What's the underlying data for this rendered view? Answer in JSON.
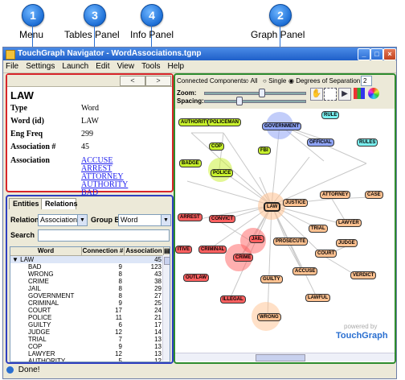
{
  "callouts": [
    {
      "number": "1",
      "label": "Menu"
    },
    {
      "number": "3",
      "label": "Tables Panel"
    },
    {
      "number": "4",
      "label": "Info Panel"
    },
    {
      "number": "2",
      "label": "Graph Panel"
    }
  ],
  "window": {
    "title": "TouchGraph Navigator - WordAssociations.tgnp",
    "buttons": [
      "_",
      "□",
      "×"
    ]
  },
  "menubar": {
    "items": [
      "File",
      "Settings",
      "Launch",
      "Edit",
      "View",
      "Tools",
      "Help"
    ]
  },
  "info_panel": {
    "nav_back": "<",
    "nav_forward": ">",
    "title": "LAW",
    "rows": [
      {
        "key": "Type",
        "value": "Word"
      },
      {
        "key": "Word (id)",
        "value": "LAW"
      },
      {
        "key": "Eng Freq",
        "value": "299"
      },
      {
        "key": "Association #",
        "value": "45"
      }
    ],
    "association_key": "Association",
    "associations": [
      "ACCUSE",
      "ARREST",
      "ATTORNEY",
      "AUTHORITY",
      "BAD"
    ]
  },
  "tables_panel": {
    "tabs": [
      "Entities",
      "Relations"
    ],
    "relation_label": "Relation:",
    "relation_value": "Association",
    "group_by_label": "Group By:",
    "group_by_value": "Word",
    "search_label": "Search",
    "search_value": "",
    "columns": [
      "Word",
      "Connection #",
      "Association #"
    ],
    "group_row": {
      "word": "LAW",
      "association": "45"
    },
    "rows": [
      {
        "word": "BAD",
        "connection": "9",
        "association": "123"
      },
      {
        "word": "WRONG",
        "connection": "8",
        "association": "43"
      },
      {
        "word": "CRIME",
        "connection": "8",
        "association": "38"
      },
      {
        "word": "JAIL",
        "connection": "8",
        "association": "29"
      },
      {
        "word": "GOVERNMENT",
        "connection": "8",
        "association": "27"
      },
      {
        "word": "CRIMINAL",
        "connection": "9",
        "association": "25"
      },
      {
        "word": "COURT",
        "connection": "17",
        "association": "24"
      },
      {
        "word": "POLICE",
        "connection": "11",
        "association": "21"
      },
      {
        "word": "GUILTY",
        "connection": "6",
        "association": "17"
      },
      {
        "word": "JUDGE",
        "connection": "12",
        "association": "14"
      },
      {
        "word": "TRIAL",
        "connection": "7",
        "association": "13"
      },
      {
        "word": "COP",
        "connection": "9",
        "association": "13"
      },
      {
        "word": "LAWYER",
        "connection": "12",
        "association": "13"
      },
      {
        "word": "AUTHORITY",
        "connection": "5",
        "association": "12"
      }
    ]
  },
  "graph_panel": {
    "connected_label": "Connected Components:",
    "options": [
      "All",
      "Single",
      "Degrees of Separation"
    ],
    "selected_option": "Degrees of Separation",
    "degrees_value": "2",
    "zoom_label": "Zoom:",
    "spacing_label": "Spacing:",
    "watermark_top": "powered by",
    "watermark_brand": "TouchGraph",
    "nodes": [
      {
        "label": "AUTHORITY",
        "color": "lime"
      },
      {
        "label": "POLICEMAN",
        "color": "lime"
      },
      {
        "label": "COP",
        "color": "lime"
      },
      {
        "label": "FBI",
        "color": "lime"
      },
      {
        "label": "BADGE",
        "color": "lime"
      },
      {
        "label": "POLICE",
        "color": "lime"
      },
      {
        "label": "GOVERNMENT",
        "color": "blue"
      },
      {
        "label": "OFFICIAL",
        "color": "blue"
      },
      {
        "label": "RULE",
        "color": "cyan"
      },
      {
        "label": "RULES",
        "color": "cyan"
      },
      {
        "label": "LAW",
        "color": "orange"
      },
      {
        "label": "JUSTICE",
        "color": "orange"
      },
      {
        "label": "ATTORNEY",
        "color": "orange"
      },
      {
        "label": "CASE",
        "color": "orange"
      },
      {
        "label": "LAWYER",
        "color": "orange"
      },
      {
        "label": "TRIAL",
        "color": "orange"
      },
      {
        "label": "JUDGE",
        "color": "orange"
      },
      {
        "label": "COURT",
        "color": "orange"
      },
      {
        "label": "PROSECUTE",
        "color": "orange"
      },
      {
        "label": "ACCUSE",
        "color": "orange"
      },
      {
        "label": "VERDICT",
        "color": "orange"
      },
      {
        "label": "GUILTY",
        "color": "orange"
      },
      {
        "label": "LAWFUL",
        "color": "orange"
      },
      {
        "label": "WRONG",
        "color": "orange"
      },
      {
        "label": "ARREST",
        "color": "red"
      },
      {
        "label": "CONVICT",
        "color": "red"
      },
      {
        "label": "JAIL",
        "color": "red"
      },
      {
        "label": "CRIMINAL",
        "color": "red"
      },
      {
        "label": "CRIME",
        "color": "red"
      },
      {
        "label": "OUTLAW",
        "color": "red"
      },
      {
        "label": "ILLEGAL",
        "color": "red"
      },
      {
        "label": "ITIVE",
        "color": "red"
      }
    ]
  },
  "status": {
    "text": "Done!"
  },
  "colors": {
    "info_border": "#d8252a",
    "tables_border": "#2f3fbf",
    "graph_border": "#2e8c2e",
    "callout": "#1d6fd6"
  }
}
